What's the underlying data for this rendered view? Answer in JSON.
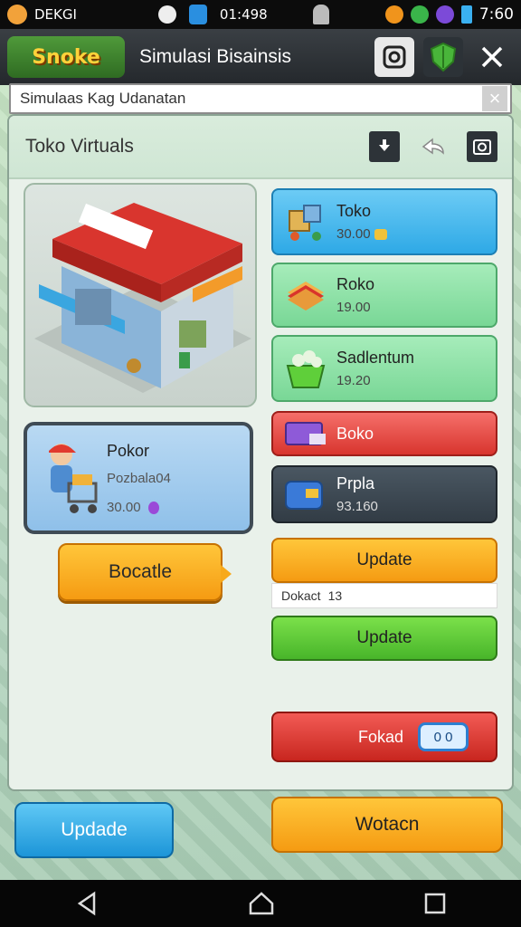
{
  "status_bar": {
    "left_label": "DEKGI",
    "time_mid": "01:498",
    "clock": "7:60"
  },
  "app_bar": {
    "logo_text": "Snoke",
    "title": "Simulasi Bisainsis"
  },
  "search": {
    "value": "Simulaas Kag Udanatan"
  },
  "panel": {
    "title": "Toko Virtuals"
  },
  "profile": {
    "name": "Pokor",
    "subtitle": "Pozbala04",
    "value": "30.00"
  },
  "left_button": "Bocatle",
  "items": [
    {
      "name": "Toko",
      "price": "30.00",
      "color": "#5cc2f2"
    },
    {
      "name": "Roko",
      "price": "19.00",
      "color": "#8fe0a6"
    },
    {
      "name": "Sadlentum",
      "price": "19.20",
      "color": "#8fe0a6"
    },
    {
      "name": "Boko",
      "price": "",
      "color": "#ee5a5a"
    },
    {
      "name": "Prpla",
      "price": "93.160",
      "color": "#3e4a55"
    }
  ],
  "update_orange": "Update",
  "order_line": {
    "label": "Dokact",
    "value": "13"
  },
  "update_green": "Update",
  "fokad": {
    "label": "Fokad",
    "counter": "0 0"
  },
  "bottom": {
    "left": "Updade",
    "right": "Wotacn"
  },
  "colors": {
    "orange": "#f7a91b",
    "green": "#5fcf3a",
    "red": "#d8352e",
    "blue": "#2aa7e8"
  }
}
